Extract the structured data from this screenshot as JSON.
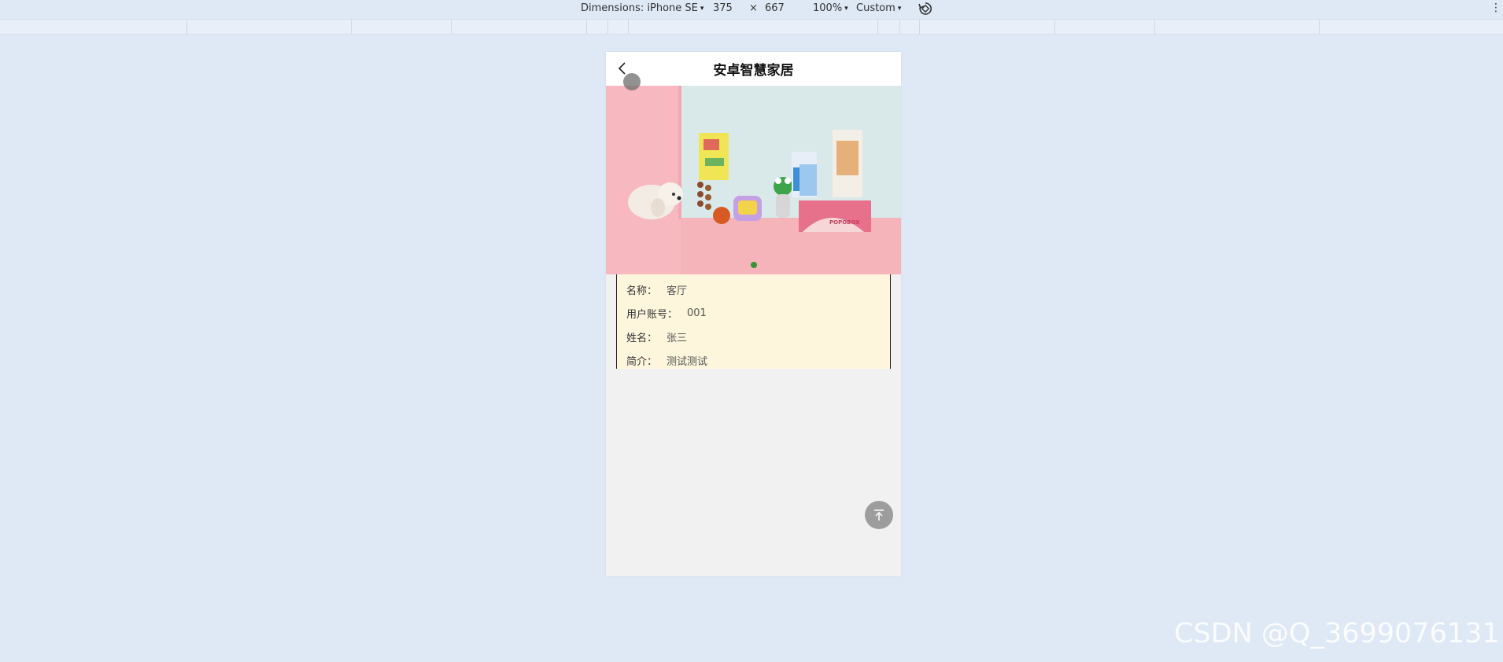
{
  "devtools": {
    "dimensions_label": "Dimensions: iPhone SE",
    "width_value": "375",
    "times": "×",
    "height_value": "667",
    "zoom": "100%",
    "throttle": "Custom",
    "caret": "▾",
    "kebab": "⋮"
  },
  "app": {
    "title": "安卓智慧家居",
    "back_icon": "chevron-left-icon"
  },
  "banner": {
    "box_text": "POPOBOX",
    "active_dot": 1,
    "dot_color": "#3a8f3a"
  },
  "info": [
    {
      "label": "名称：",
      "value": "客厅"
    },
    {
      "label": "用户账号：",
      "value": "001"
    },
    {
      "label": "姓名：",
      "value": "张三"
    },
    {
      "label": "简介：",
      "value": "测试测试"
    }
  ],
  "back_to_top_icon": "arrow-up-to-line-icon",
  "watermark": "CSDN @Q_3699076131",
  "colors": {
    "page_bg": "#dfe8f5",
    "card_bg": "#fdf6dd",
    "banner_pink": "#f7b9bf"
  }
}
